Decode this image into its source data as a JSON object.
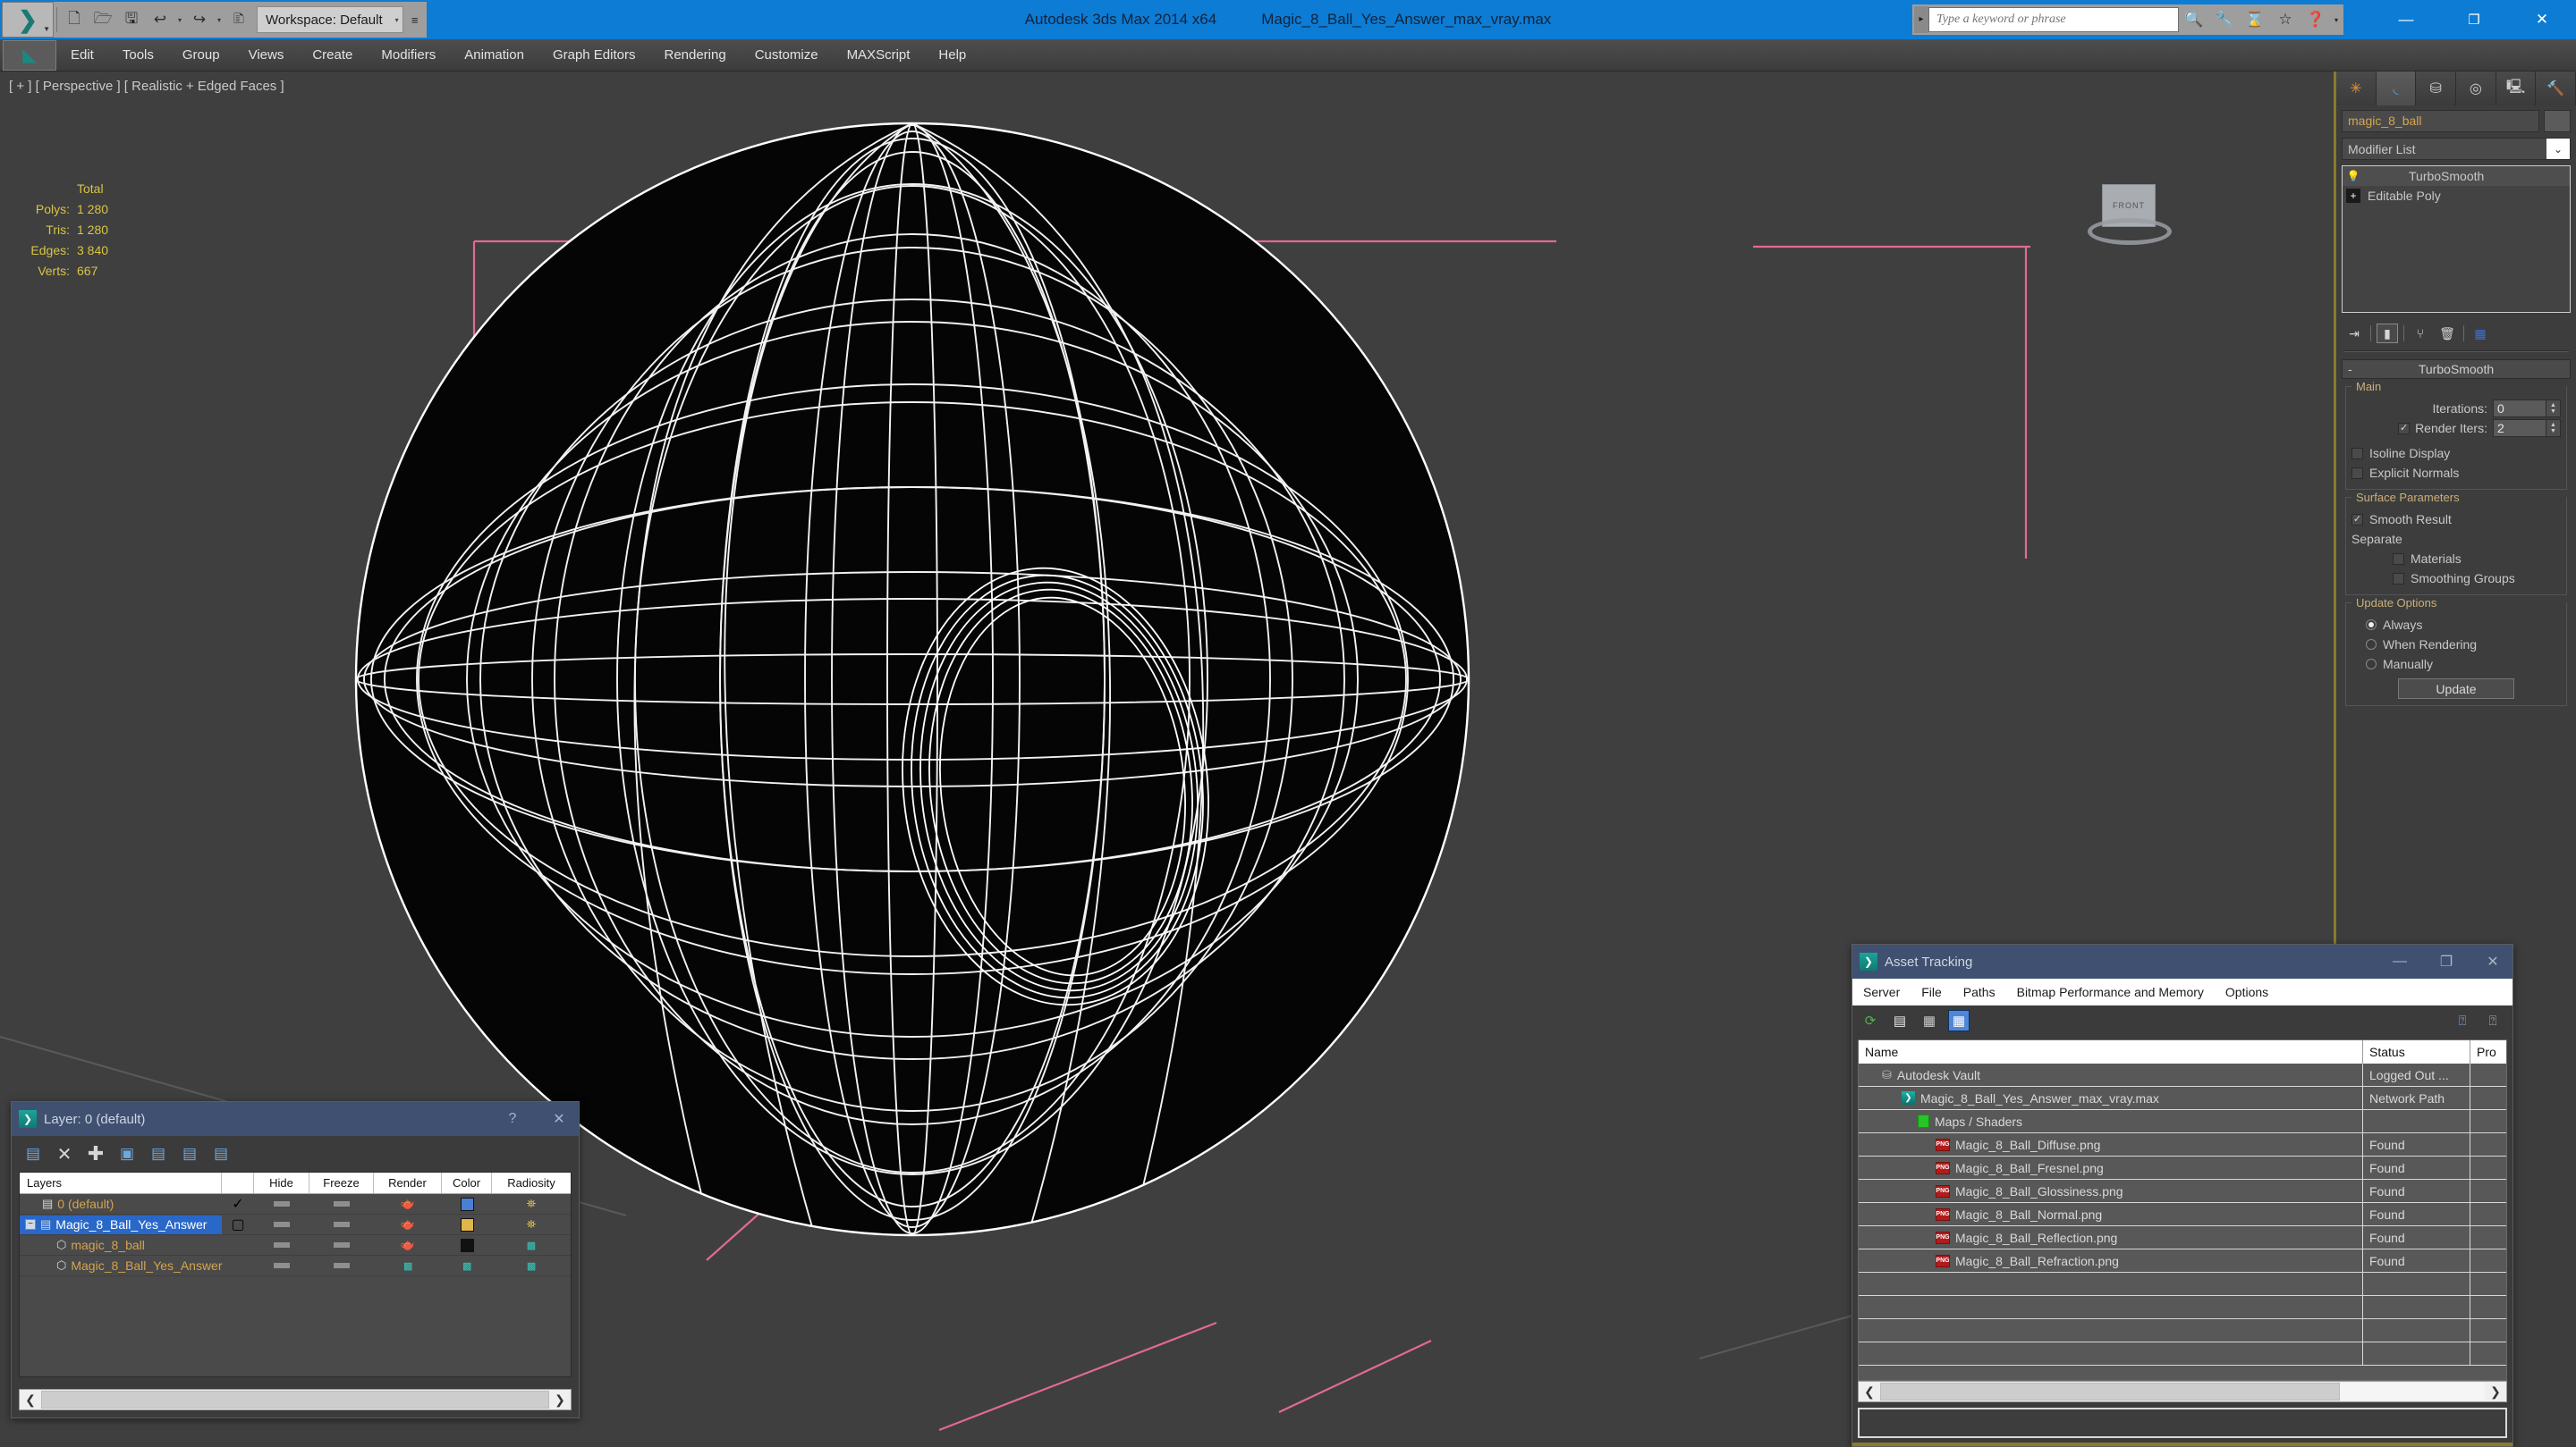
{
  "titlebar": {
    "app_title": "Autodesk 3ds Max  2014 x64",
    "file_title": "Magic_8_Ball_Yes_Answer_max_vray.max",
    "workspace_label": "Workspace: Default",
    "workspace_caret": "▾",
    "qat": [
      {
        "name": "new-file-icon",
        "glyph": "🗋"
      },
      {
        "name": "open-file-icon",
        "glyph": "🗁"
      },
      {
        "name": "save-file-icon",
        "glyph": "🖫"
      },
      {
        "name": "undo-icon",
        "glyph": "↩"
      },
      {
        "name": "undo-dropdown-icon",
        "glyph": "▾"
      },
      {
        "name": "redo-icon",
        "glyph": "↪"
      },
      {
        "name": "redo-dropdown-icon",
        "glyph": "▾"
      },
      {
        "name": "project-folder-icon",
        "glyph": "🗈"
      }
    ],
    "qat_more": "≡",
    "search_placeholder": "Type a keyword or phrase",
    "info_buttons": [
      {
        "name": "search-binoculars-icon",
        "glyph": "🔍"
      },
      {
        "name": "wrench-icon",
        "glyph": "🔧"
      },
      {
        "name": "subscription-icon",
        "glyph": "⌛"
      },
      {
        "name": "favorites-star-icon",
        "glyph": "☆"
      },
      {
        "name": "help-icon",
        "glyph": "?"
      }
    ],
    "window_controls": {
      "minimize": "—",
      "maximize": "❐",
      "close": "✕"
    }
  },
  "menubar": {
    "app_glyph": "◣",
    "items": [
      "Edit",
      "Tools",
      "Group",
      "Views",
      "Create",
      "Modifiers",
      "Animation",
      "Graph Editors",
      "Rendering",
      "Customize",
      "MAXScript",
      "Help"
    ]
  },
  "viewport": {
    "label": "[ + ] [ Perspective ] [ Realistic + Edged Faces ]",
    "stats_header": "Total",
    "stats": [
      {
        "label": "Polys:",
        "value": "1 280"
      },
      {
        "label": "Tris:",
        "value": "1 280"
      },
      {
        "label": "Edges:",
        "value": "3 840"
      },
      {
        "label": "Verts:",
        "value": "667"
      }
    ],
    "viewcube_face": "FRONT",
    "colors": {
      "background": "#3f3f3f",
      "wireframe": "#ffffff",
      "helper_pink": "#e06a96",
      "stats_text": "#d8c447"
    }
  },
  "command_panel": {
    "tabs": [
      {
        "name": "tab-create",
        "glyph": "✳",
        "active": false
      },
      {
        "name": "tab-modify",
        "glyph": "◜",
        "active": true
      },
      {
        "name": "tab-hierarchy",
        "glyph": "⛁",
        "active": false
      },
      {
        "name": "tab-motion",
        "glyph": "◎",
        "active": false
      },
      {
        "name": "tab-display",
        "glyph": "🖥",
        "active": false
      },
      {
        "name": "tab-utilities",
        "glyph": "🔨",
        "active": false
      }
    ],
    "object_name": "magic_8_ball",
    "modifier_list_label": "Modifier List",
    "modifier_list_caret": "⌄",
    "stack": [
      {
        "icon": "lightbulb-icon",
        "glyph": "💡",
        "label": "TurboSmooth",
        "selected": true
      },
      {
        "icon": "expand-plus-icon",
        "glyph": "+",
        "label": "Editable Poly",
        "selected": false
      }
    ],
    "stack_tools": [
      {
        "name": "pin-stack-icon",
        "glyph": "⇥"
      },
      {
        "name": "show-end-result-icon",
        "glyph": "▮"
      },
      {
        "name": "make-unique-icon",
        "glyph": "⑂"
      },
      {
        "name": "remove-modifier-icon",
        "glyph": "🗑"
      },
      {
        "name": "configure-modifier-sets-icon",
        "glyph": "▦"
      }
    ],
    "rollout": {
      "title": "TurboSmooth",
      "minus": "-",
      "groups": [
        {
          "title": "Main",
          "fields": [
            {
              "type": "spinner",
              "label": "Iterations:",
              "value": "0"
            },
            {
              "type": "checkspinner",
              "label": "Render Iters:",
              "value": "2",
              "checked": true
            },
            {
              "type": "checkbox",
              "label": "Isoline Display",
              "checked": false
            },
            {
              "type": "checkbox",
              "label": "Explicit Normals",
              "checked": false
            }
          ]
        },
        {
          "title": "Surface Parameters",
          "fields": [
            {
              "type": "checkbox",
              "label": "Smooth Result",
              "checked": true
            },
            {
              "type": "text",
              "label": "Separate"
            },
            {
              "type": "checkbox-indent",
              "label": "Materials",
              "checked": false
            },
            {
              "type": "checkbox-indent",
              "label": "Smoothing Groups",
              "checked": false
            }
          ]
        },
        {
          "title": "Update Options",
          "fields": [
            {
              "type": "radio",
              "label": "Always",
              "checked": true
            },
            {
              "type": "radio",
              "label": "When Rendering",
              "checked": false
            },
            {
              "type": "radio",
              "label": "Manually",
              "checked": false
            },
            {
              "type": "button",
              "label": "Update"
            }
          ]
        }
      ]
    }
  },
  "layer_dialog": {
    "title": "Layer: 0 (default)",
    "help_btn": "?",
    "close_btn": "✕",
    "toolbar": [
      {
        "name": "create-new-layer-icon",
        "glyph": "▤"
      },
      {
        "name": "delete-layer-icon",
        "glyph": "✕"
      },
      {
        "name": "add-layer-icon",
        "glyph": "✚"
      },
      {
        "name": "select-objects-in-layer-icon",
        "glyph": "▣"
      },
      {
        "name": "select-highlighted-objects-icon",
        "glyph": "▤"
      },
      {
        "name": "highlight-selected-objects-icon",
        "glyph": "▤"
      },
      {
        "name": "layer-properties-icon",
        "glyph": "▤"
      }
    ],
    "columns": [
      "Layers",
      "",
      "Hide",
      "Freeze",
      "Render",
      "Color",
      "Radiosity"
    ],
    "rows": [
      {
        "name": "0 (default)",
        "indent": 0,
        "expander": "",
        "icon": "layer-icon",
        "selected": false,
        "active_check": "✓",
        "hide": "dash",
        "freeze": "dash",
        "render": "teapot",
        "color": "#4a7fd6",
        "radiosity": "lamp"
      },
      {
        "name": "Magic_8_Ball_Yes_Answer",
        "indent": 0,
        "expander": "−",
        "icon": "layer-icon",
        "selected": true,
        "active_check": "▢",
        "hide": "dash",
        "freeze": "dash",
        "render": "teapot",
        "color": "#e0b64a",
        "radiosity": "lamp"
      },
      {
        "name": "magic_8_ball",
        "indent": 1,
        "expander": "",
        "icon": "object-icon",
        "selected": false,
        "active_check": "",
        "hide": "dash",
        "freeze": "dash",
        "render": "teapot",
        "color": "#1a1a1a",
        "radiosity": "dots"
      },
      {
        "name": "Magic_8_Ball_Yes_Answer",
        "indent": 1,
        "expander": "",
        "icon": "object-icon",
        "selected": false,
        "active_check": "",
        "hide": "dash",
        "freeze": "dash",
        "render": "dots",
        "color": "dots",
        "radiosity": "dots"
      }
    ],
    "scroll": {
      "left_arrow": "❮",
      "right_arrow": "❯",
      "thumb_pct": 100
    }
  },
  "asset_dialog": {
    "title": "Asset Tracking",
    "window_controls": {
      "minimize": "—",
      "maximize": "❐",
      "close": "✕"
    },
    "menus": [
      "Server",
      "File",
      "Paths",
      "Bitmap Performance and Memory",
      "Options"
    ],
    "toolbar": [
      {
        "name": "refresh-icon",
        "glyph": "⟳",
        "selected": false
      },
      {
        "name": "list-view-icon",
        "glyph": "▤",
        "selected": false
      },
      {
        "name": "detail-view-icon",
        "glyph": "▦",
        "selected": false
      },
      {
        "name": "grid-view-icon",
        "glyph": "▦",
        "selected": true
      }
    ],
    "toolbar_right": [
      {
        "name": "check-in-icon",
        "glyph": "⍰"
      },
      {
        "name": "check-out-icon",
        "glyph": "⍰"
      }
    ],
    "columns": [
      "Name",
      "Status",
      "Pro"
    ],
    "rows": [
      {
        "name": "Autodesk Vault",
        "indent": 0,
        "icon": "vault-icon",
        "status": "Logged Out ...",
        "pro": ""
      },
      {
        "name": "Magic_8_Ball_Yes_Answer_max_vray.max",
        "indent": 1,
        "icon": "max-file-icon",
        "status": "Network Path",
        "pro": ""
      },
      {
        "name": "Maps / Shaders",
        "indent": 2,
        "icon": "maps-icon",
        "status": "",
        "pro": ""
      },
      {
        "name": "Magic_8_Ball_Diffuse.png",
        "indent": 3,
        "icon": "png-icon",
        "status": "Found",
        "pro": ""
      },
      {
        "name": "Magic_8_Ball_Fresnel.png",
        "indent": 3,
        "icon": "png-icon",
        "status": "Found",
        "pro": ""
      },
      {
        "name": "Magic_8_Ball_Glossiness.png",
        "indent": 3,
        "icon": "png-icon",
        "status": "Found",
        "pro": ""
      },
      {
        "name": "Magic_8_Ball_Normal.png",
        "indent": 3,
        "icon": "png-icon",
        "status": "Found",
        "pro": ""
      },
      {
        "name": "Magic_8_Ball_Reflection.png",
        "indent": 3,
        "icon": "png-icon",
        "status": "Found",
        "pro": ""
      },
      {
        "name": "Magic_8_Ball_Refraction.png",
        "indent": 3,
        "icon": "png-icon",
        "status": "Found",
        "pro": ""
      }
    ],
    "scroll": {
      "left_arrow": "❮",
      "right_arrow": "❯",
      "thumb_pct": 76
    }
  }
}
